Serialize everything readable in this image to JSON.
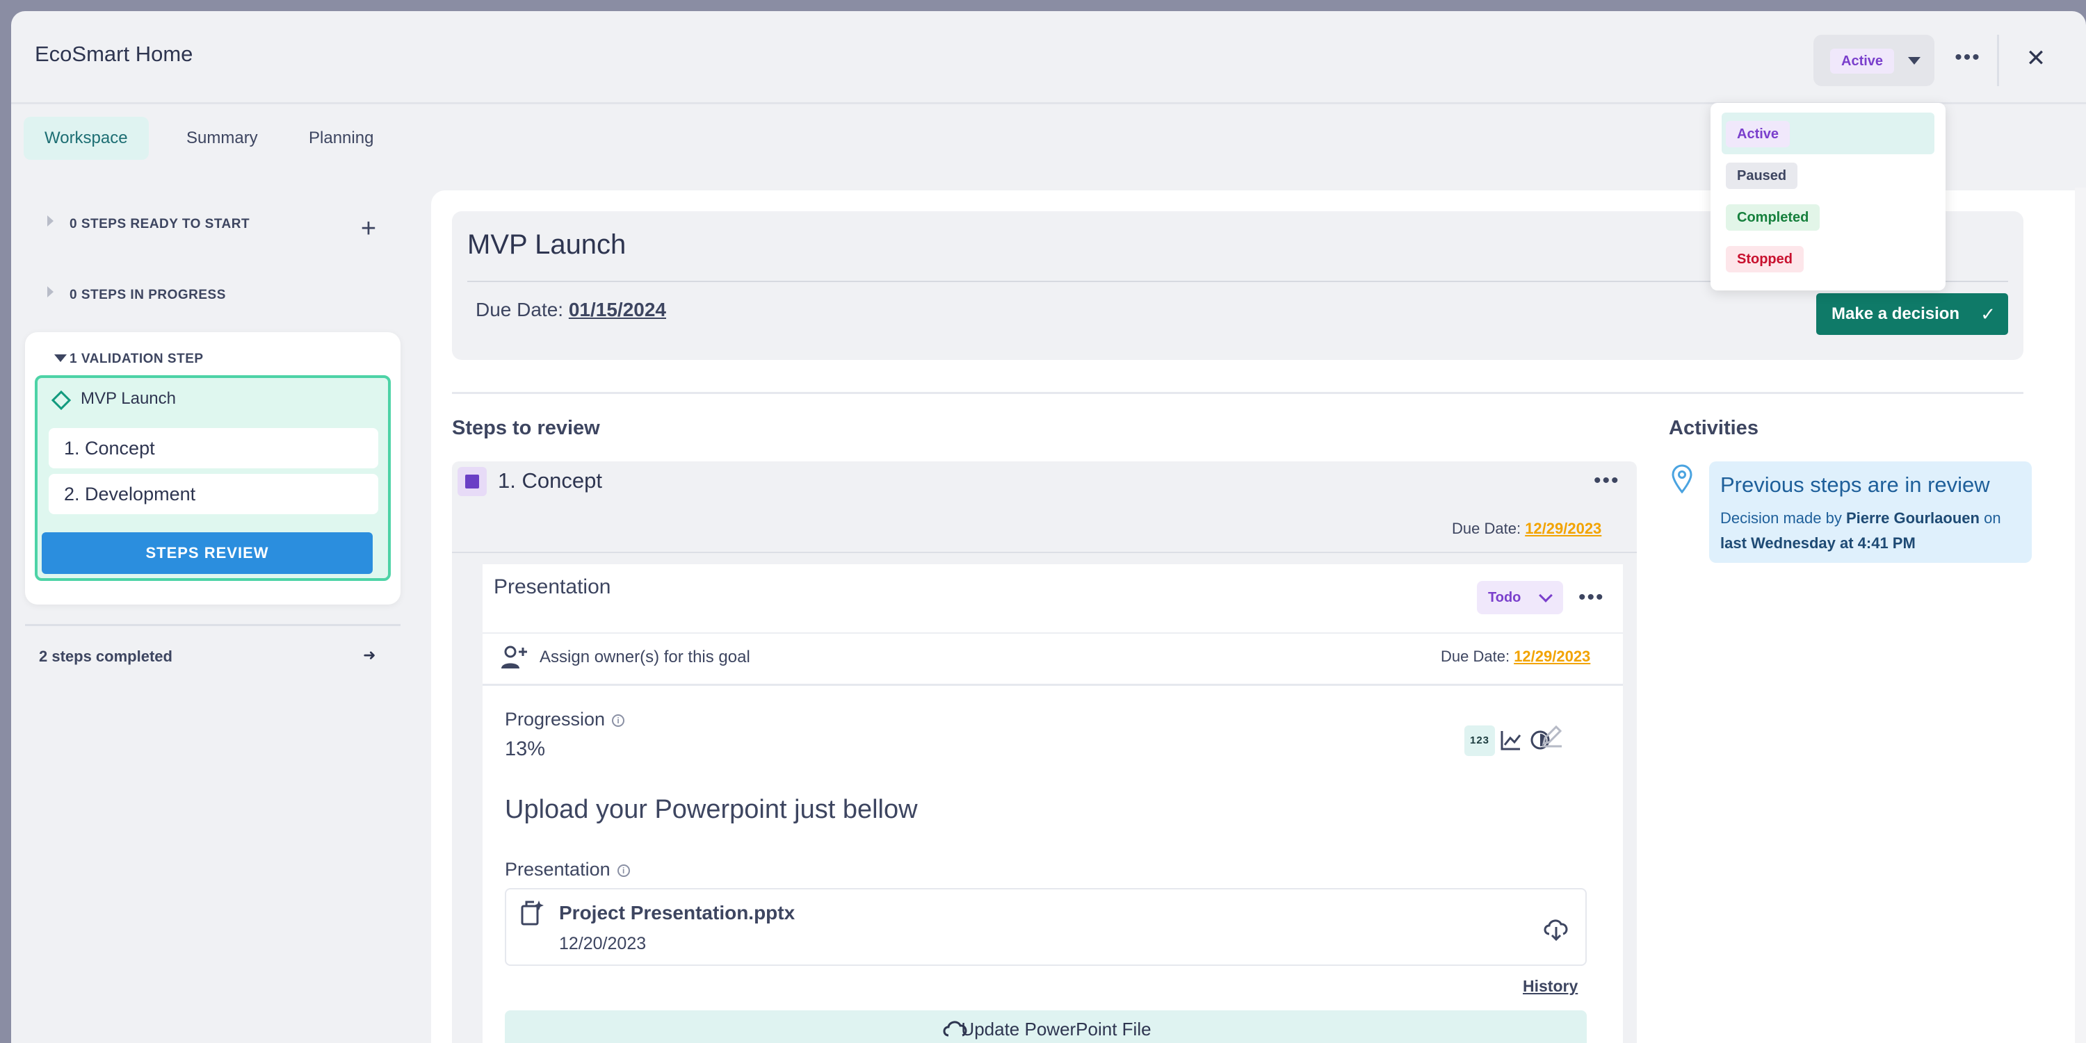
{
  "app": {
    "title": "EcoSmart Home"
  },
  "header": {
    "status": "Active",
    "more": "•••",
    "close": "✕"
  },
  "tabs": [
    {
      "label": "Workspace",
      "active": true
    },
    {
      "label": "Summary",
      "active": false
    },
    {
      "label": "Planning",
      "active": false
    }
  ],
  "sidebar": {
    "ready": "0 STEPS READY TO START",
    "in_progress": "0 STEPS IN PROGRESS",
    "validation": "1 VALIDATION STEP",
    "validation_name": "MVP Launch",
    "sub_steps": [
      "1. Concept",
      "2. Development"
    ],
    "review_button": "STEPS REVIEW",
    "completed": "2 steps completed",
    "add": "+",
    "arrow": "➜"
  },
  "hero": {
    "title": "MVP Launch",
    "due_label": "Due Date:",
    "due_value": "01/15/2024",
    "decision_button": "Make a decision",
    "decision_check": "✓"
  },
  "steps": {
    "section_title": "Steps to review",
    "step": {
      "title": "1. Concept",
      "due_label": "Due Date:",
      "due_value": "12/29/2023",
      "more": "•••"
    },
    "goal": {
      "title": "Presentation",
      "status": "Todo",
      "more": "•••",
      "assign": "Assign owner(s) for this goal",
      "due_label": "Due Date:",
      "due_value": "12/29/2023",
      "progression_label": "Progression",
      "progression_value": "13%",
      "view_123": "123",
      "upload_heading": "Upload your Powerpoint just bellow",
      "presentation_label": "Presentation",
      "file_name": "Project Presentation.pptx",
      "file_date": "12/20/2023",
      "history": "History",
      "update_button": "Update PowerPoint File"
    }
  },
  "activities": {
    "section_title": "Activities",
    "card_title": "Previous steps are in review",
    "text_prefix": "Decision made by",
    "author": "Pierre Gourlaouen",
    "text_mid": "on",
    "text_time": "last Wednesday at 4:41 PM"
  },
  "dropdown": {
    "options": [
      "Active",
      "Paused",
      "Completed",
      "Stopped"
    ],
    "selected": "Active"
  },
  "colors": {
    "accent_teal": "#0f7a68",
    "primary_blue": "#2b8ede",
    "due_orange": "#f2a300",
    "active_purple": "#7a3fcc"
  }
}
